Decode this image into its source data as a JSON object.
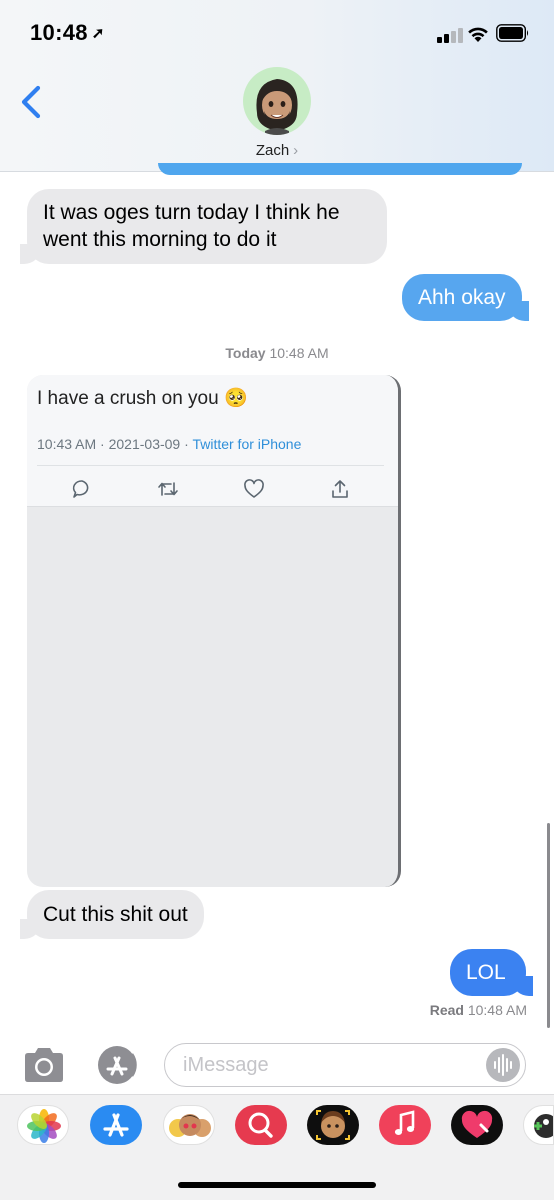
{
  "status_bar": {
    "time": "10:48",
    "location_icon": "location-arrow-icon"
  },
  "header": {
    "contact_name": "Zach",
    "chevron": "›"
  },
  "messages": [
    {
      "direction": "incoming",
      "text": "It was oges turn today I think he went this morning to do it"
    },
    {
      "direction": "outgoing",
      "text": "Ahh okay"
    }
  ],
  "timestamp": {
    "day": "Today",
    "time": "10:48 AM"
  },
  "tweet": {
    "text": "I have a crush on you 🥺",
    "time": "10:43 AM",
    "date": "2021-03-09",
    "source": "Twitter for iPhone",
    "separator": " · "
  },
  "messages_after": [
    {
      "direction": "incoming",
      "text": "Cut this shit out"
    },
    {
      "direction": "outgoing",
      "text": "LOL"
    }
  ],
  "read_receipt": {
    "label": "Read",
    "time": "10:48 AM"
  },
  "input": {
    "placeholder": "iMessage"
  },
  "app_drawer": [
    "photos-app-icon",
    "app-store-icon",
    "memoji-stickers-icon",
    "search-images-icon",
    "animoji-icon",
    "music-app-icon",
    "digital-touch-icon",
    "game-app-icon"
  ],
  "colors": {
    "outgoing": "#57a6ef",
    "outgoing_latest": "#3b82f1",
    "incoming": "#e9e9eb",
    "link": "#2f8fd9"
  }
}
